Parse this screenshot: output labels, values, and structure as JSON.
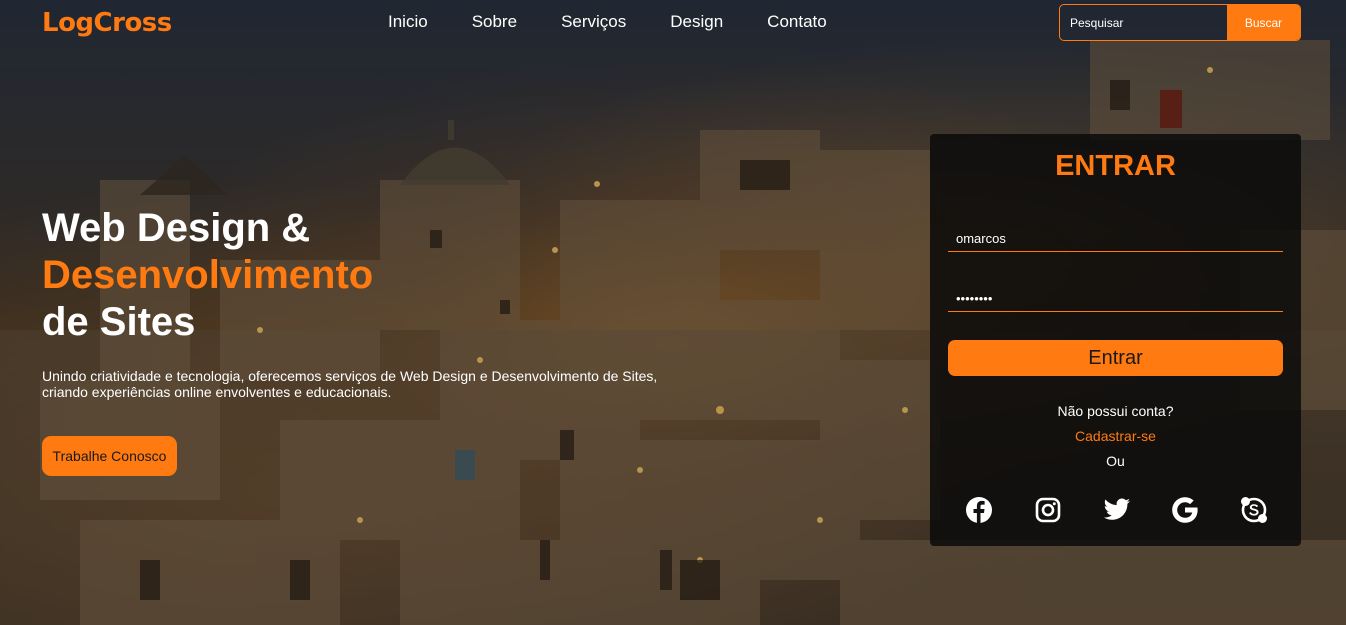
{
  "brand": {
    "logo": "LogCross",
    "accent_color": "#ff7a10"
  },
  "nav": {
    "items": [
      {
        "label": "Inicio"
      },
      {
        "label": "Sobre"
      },
      {
        "label": "Serviços"
      },
      {
        "label": "Design"
      },
      {
        "label": "Contato"
      }
    ]
  },
  "search": {
    "placeholder": "Pesquisar",
    "button_label": "Buscar"
  },
  "hero": {
    "title_line1": "Web Design &",
    "title_line2": "Desenvolvimento",
    "title_line3": "de Sites",
    "description": "Unindo criatividade e tecnologia, oferecemos serviços de Web Design e Desenvolvimento de Sites, criando experiências online envolventes e educacionais.",
    "cta_label": "Trabalhe Conosco"
  },
  "login": {
    "title": "ENTRAR",
    "username_value": "omarcos",
    "password_value": "••••••••",
    "submit_label": "Entrar",
    "no_account_text": "Não possui conta?",
    "signup_label": "Cadastrar-se",
    "or_text": "Ou",
    "socials": [
      "facebook-icon",
      "instagram-icon",
      "twitter-icon",
      "google-icon",
      "skype-icon"
    ]
  }
}
